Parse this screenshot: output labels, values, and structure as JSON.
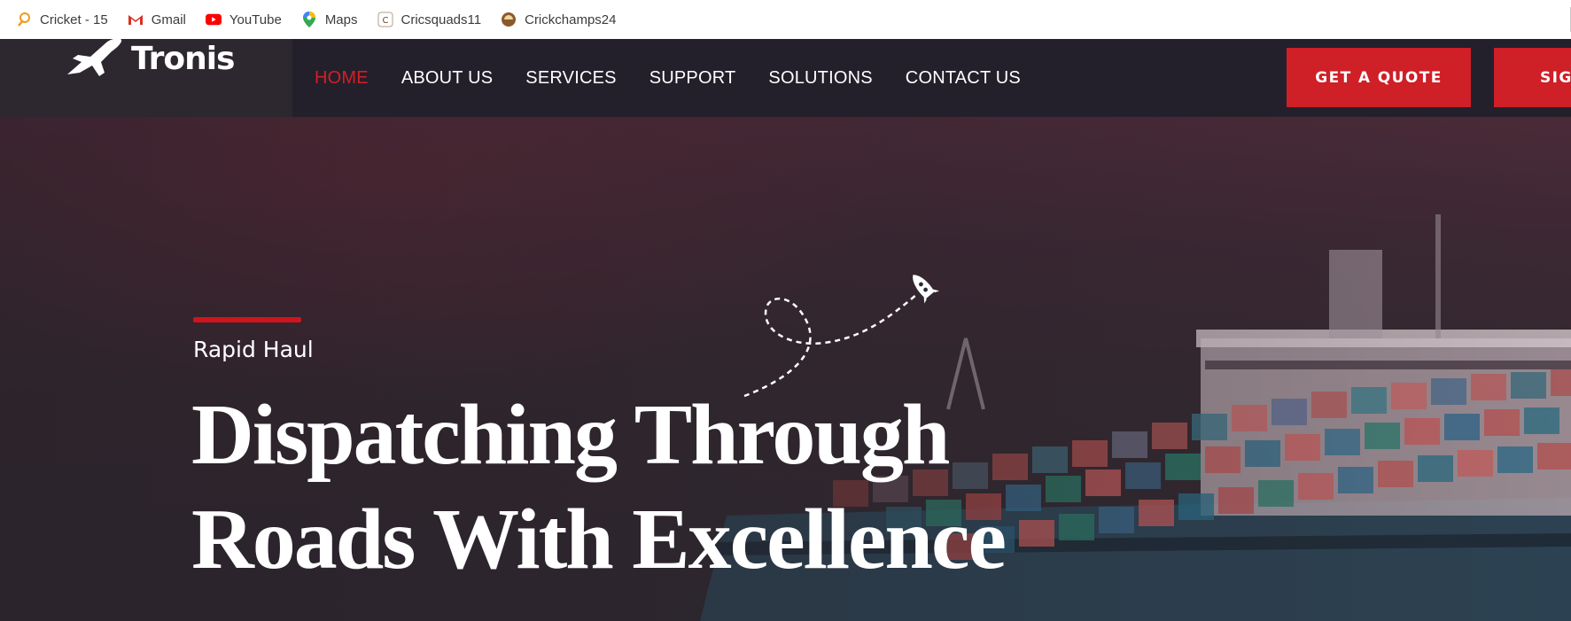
{
  "bookmarks": [
    {
      "label": "Cricket - 15",
      "icon": "cricket-icon"
    },
    {
      "label": "Gmail",
      "icon": "gmail-icon"
    },
    {
      "label": "YouTube",
      "icon": "youtube-icon"
    },
    {
      "label": "Maps",
      "icon": "maps-icon"
    },
    {
      "label": "Cricsquads11",
      "icon": "cricsquads-icon"
    },
    {
      "label": "Crickchamps24",
      "icon": "crickchamps-icon"
    }
  ],
  "header": {
    "logo_text": "Tronis",
    "nav": [
      {
        "label": "HOME",
        "active": true
      },
      {
        "label": "ABOUT US",
        "active": false
      },
      {
        "label": "SERVICES",
        "active": false
      },
      {
        "label": "SUPPORT",
        "active": false
      },
      {
        "label": "SOLUTIONS",
        "active": false
      },
      {
        "label": "CONTACT US",
        "active": false
      }
    ],
    "quote_button": "GET A QUOTE",
    "sign_button": "SIG"
  },
  "hero": {
    "tagline": "Rapid Haul",
    "headline_line1": "Dispatching Through",
    "headline_line2": "Roads With Excellence"
  },
  "colors": {
    "accent": "#d0141d",
    "nav_bg": "#23202c",
    "nav_active": "#d51e25"
  }
}
